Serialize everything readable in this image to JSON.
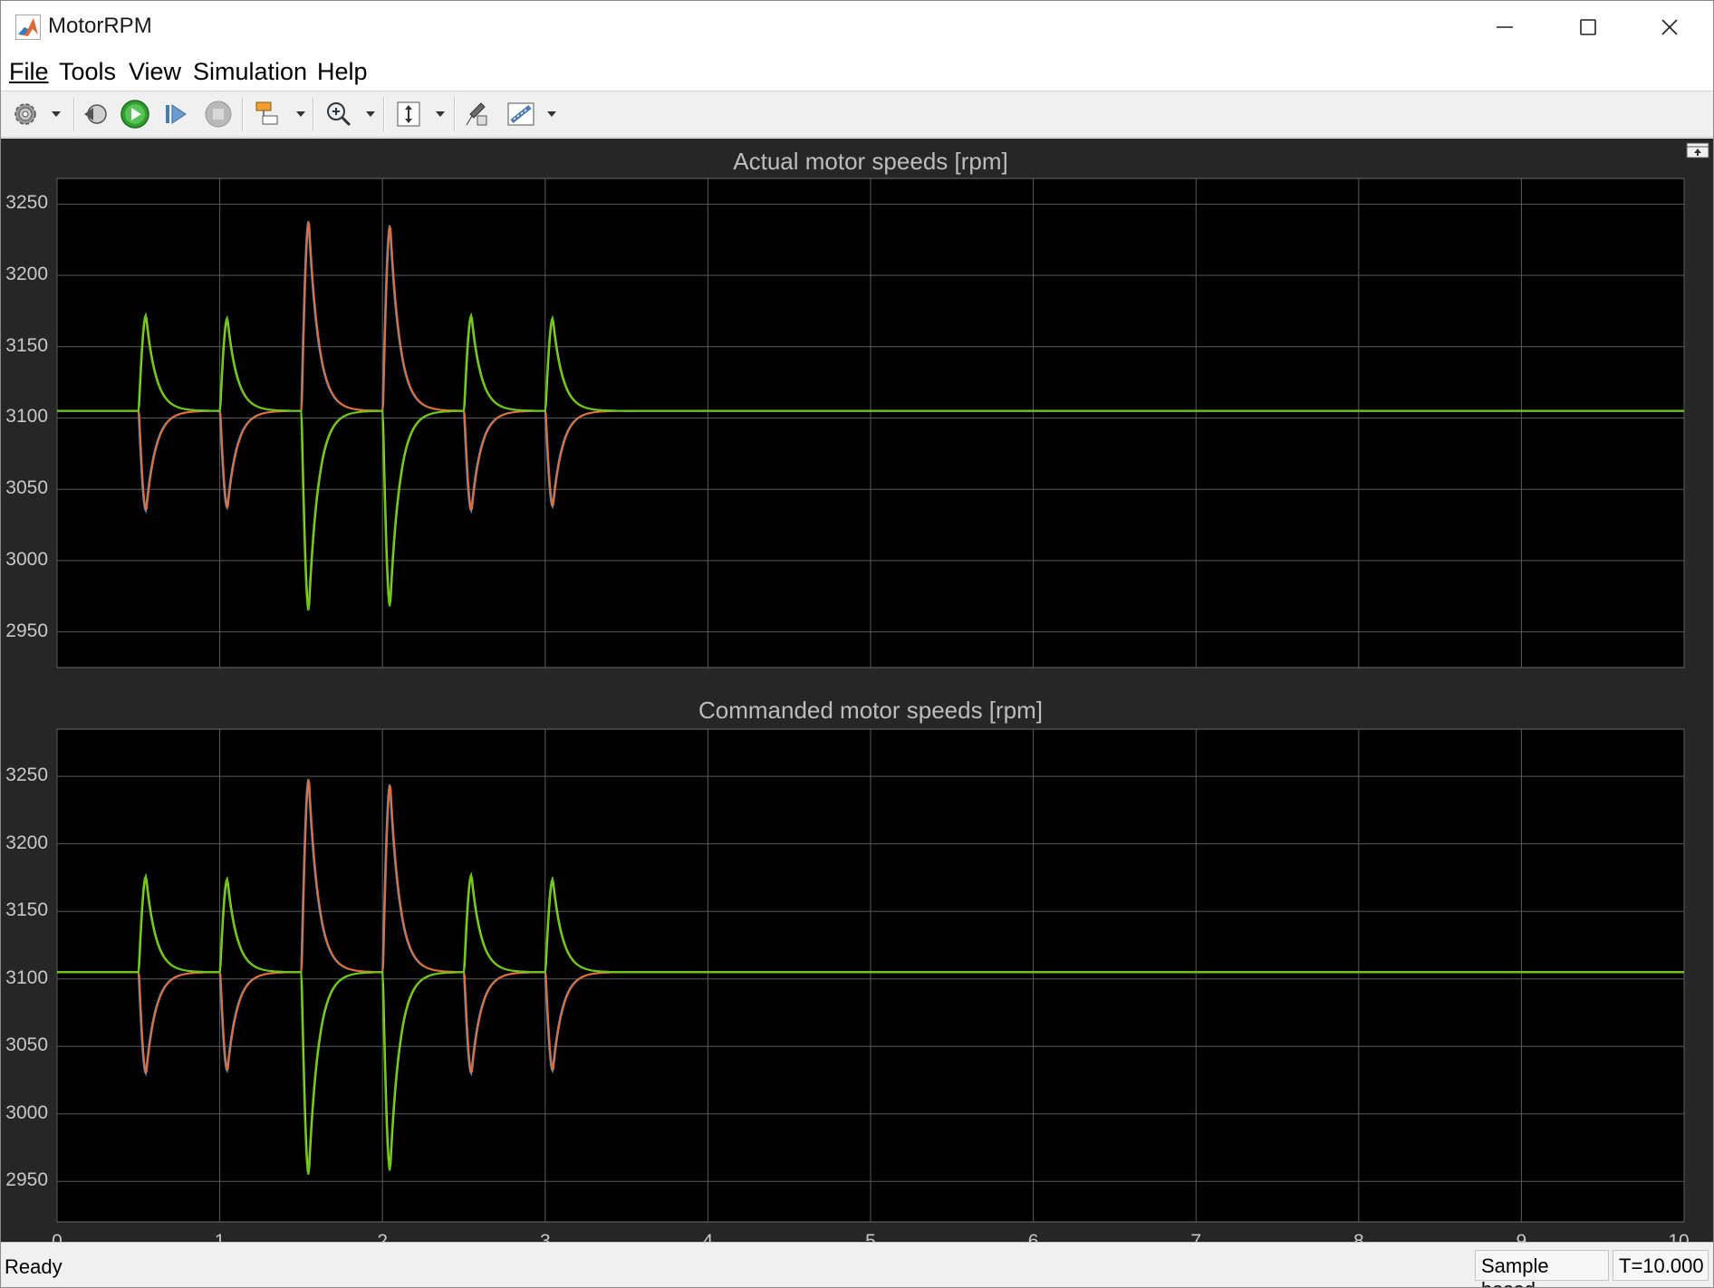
{
  "window": {
    "title": "MotorRPM"
  },
  "menu": {
    "items": [
      {
        "label": "File"
      },
      {
        "label": "Tools"
      },
      {
        "label": "View"
      },
      {
        "label": "Simulation"
      },
      {
        "label": "Help"
      }
    ]
  },
  "icons": {
    "app": "matlab-icon",
    "toolbar": [
      "gear-icon",
      "step-back-icon",
      "run-icon",
      "step-forward-icon",
      "stop-icon",
      "highlight-icon",
      "zoom-icon",
      "scale-axes-icon",
      "properties-icon",
      "measurements-icon"
    ]
  },
  "status": {
    "ready": "Ready",
    "mode": "Sample based",
    "time": "T=10.000"
  },
  "colors": {
    "blue": "#1ba2ef",
    "orange": "#ee6a2f",
    "yellow": "#e4e41a",
    "green": "#64c71a",
    "grid": "#5a5a5a",
    "axes_bg": "#000000",
    "scope_bg": "#262626"
  },
  "chart_data": [
    {
      "type": "line",
      "title": "Actual motor speeds [rpm]",
      "xlim": [
        0,
        10
      ],
      "ylim": [
        2925,
        3268
      ],
      "yticks": [
        2950,
        3000,
        3050,
        3100,
        3150,
        3200,
        3250
      ],
      "xticks": [
        0,
        1,
        2,
        3,
        4,
        5,
        6,
        7,
        8,
        9,
        10
      ],
      "grid": true,
      "baseline": 3105,
      "events": [
        {
          "t": 0.5,
          "up": 3172,
          "down": 3035,
          "series_up": [
            "green",
            "yellow"
          ],
          "series_down": [
            "blue",
            "orange"
          ]
        },
        {
          "t": 1.0,
          "up": 3170,
          "down": 3037,
          "series_up": [
            "green",
            "yellow"
          ],
          "series_down": [
            "orange",
            "blue"
          ]
        },
        {
          "t": 1.5,
          "up": 3238,
          "down": 2965,
          "series_up": [
            "blue",
            "orange"
          ],
          "series_down": [
            "green",
            "yellow"
          ]
        },
        {
          "t": 2.0,
          "up": 3235,
          "down": 2968,
          "series_up": [
            "orange",
            "blue"
          ],
          "series_down": [
            "green",
            "yellow"
          ]
        },
        {
          "t": 2.5,
          "up": 3172,
          "down": 3035,
          "series_up": [
            "green",
            "yellow"
          ],
          "series_down": [
            "blue",
            "orange"
          ]
        },
        {
          "t": 3.0,
          "up": 3170,
          "down": 3038,
          "series_up": [
            "green",
            "yellow"
          ],
          "series_down": [
            "orange",
            "blue"
          ]
        }
      ]
    },
    {
      "type": "line",
      "title": "Commanded motor speeds [rpm]",
      "xlim": [
        0,
        10
      ],
      "ylim": [
        2920,
        3285
      ],
      "yticks": [
        2950,
        3000,
        3050,
        3100,
        3150,
        3200,
        3250
      ],
      "xticks": [
        0,
        1,
        2,
        3,
        4,
        5,
        6,
        7,
        8,
        9,
        10
      ],
      "grid": true,
      "baseline": 3105,
      "events": [
        {
          "t": 0.5,
          "up": 3176,
          "down": 3030,
          "series_up": [
            "green",
            "yellow"
          ],
          "series_down": [
            "blue",
            "orange"
          ]
        },
        {
          "t": 1.0,
          "up": 3174,
          "down": 3032,
          "series_up": [
            "green",
            "yellow"
          ],
          "series_down": [
            "orange",
            "blue"
          ]
        },
        {
          "t": 1.5,
          "up": 3248,
          "down": 2955,
          "series_up": [
            "blue",
            "orange"
          ],
          "series_down": [
            "green",
            "yellow"
          ]
        },
        {
          "t": 2.0,
          "up": 3244,
          "down": 2958,
          "series_up": [
            "orange",
            "blue"
          ],
          "series_down": [
            "green",
            "yellow"
          ]
        },
        {
          "t": 2.5,
          "up": 3177,
          "down": 3030,
          "series_up": [
            "green",
            "yellow"
          ],
          "series_down": [
            "blue",
            "orange"
          ]
        },
        {
          "t": 3.0,
          "up": 3174,
          "down": 3032,
          "series_up": [
            "green",
            "yellow"
          ],
          "series_down": [
            "orange",
            "blue"
          ]
        }
      ]
    }
  ]
}
